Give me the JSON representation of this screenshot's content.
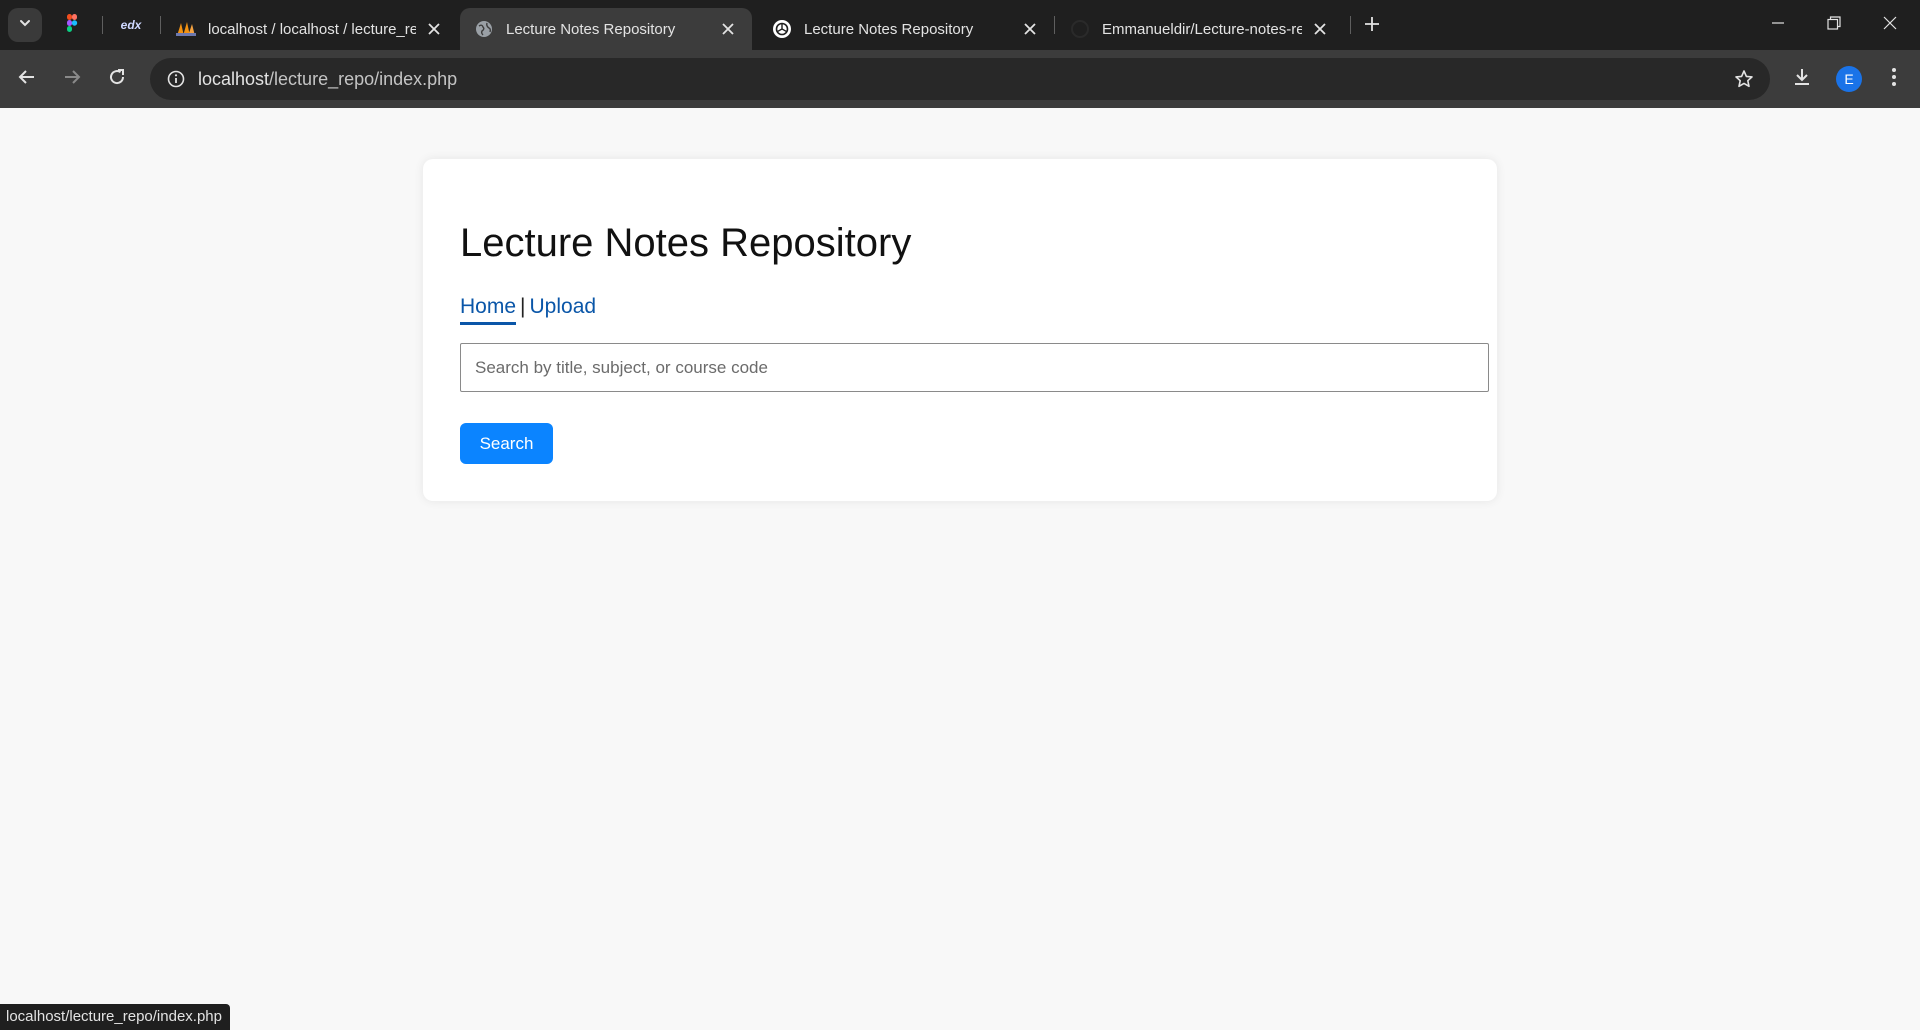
{
  "browser": {
    "tabs": [
      {
        "title": "localhost / localhost / lecture_re",
        "icon": "phpmyadmin-icon",
        "active": false
      },
      {
        "title": "Lecture Notes Repository",
        "icon": "globe-icon",
        "active": true
      },
      {
        "title": "Lecture Notes Repository",
        "icon": "openai-icon",
        "active": false
      },
      {
        "title": "Emmanueldir/Lecture-notes-rep",
        "icon": "github-icon",
        "active": false
      }
    ],
    "pinned": [
      {
        "icon": "figma-icon",
        "label": ""
      },
      {
        "icon": "edx-icon",
        "label": "edx"
      }
    ],
    "address": {
      "host": "localhost",
      "path": "/lecture_repo/index.php"
    },
    "profile_initial": "E",
    "status_url": "localhost/lecture_repo/index.php"
  },
  "page": {
    "title": "Lecture Notes Repository",
    "nav": {
      "home": "Home",
      "separator": "|",
      "upload": "Upload"
    },
    "search": {
      "placeholder": "Search by title, subject, or course code",
      "value": "",
      "button": "Search"
    }
  },
  "colors": {
    "link": "#0a56a8",
    "button": "#0b84ff",
    "chrome_dark": "#1f1f1f",
    "chrome_toolbar": "#3c3c3c"
  }
}
